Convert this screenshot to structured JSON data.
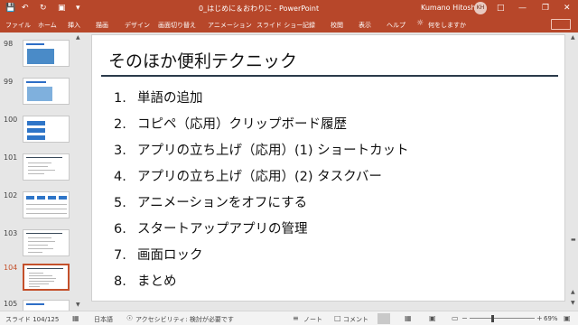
{
  "titlebar": {
    "document_title": "0_はじめに＆おわりに  -  PowerPoint",
    "user_name": "Kumano Hitoshi",
    "user_initials": "KH",
    "save_icon": "save-icon",
    "undo_icon": "undo-icon",
    "redo_icon": "redo-icon",
    "present_icon": "present-icon",
    "customize_icon": "customize-icon",
    "ribbon_display_icon": "ribbon-display-icon",
    "minimize_icon": "minimize-icon",
    "restore_icon": "restore-icon",
    "close_icon": "close-icon"
  },
  "ribbon": {
    "tabs": [
      "ファイル",
      "ホーム",
      "挿入",
      "描画",
      "デザイン",
      "画面切り替え",
      "アニメーション",
      "スライド ショー",
      "記録",
      "校閲",
      "表示",
      "ヘルプ"
    ],
    "tell_me": "何をしますか",
    "lightbulb_icon": "lightbulb-icon",
    "share_icon": "share-icon"
  },
  "thumbnails": {
    "numbers": [
      "98",
      "99",
      "100",
      "101",
      "102",
      "103",
      "104",
      "105"
    ],
    "active": "104"
  },
  "slide": {
    "title": "そのほか便利テクニック",
    "items": [
      {
        "num": "1.",
        "text": "単語の追加"
      },
      {
        "num": "2.",
        "text": "コピペ（応用）クリップボード履歴"
      },
      {
        "num": "3.",
        "text": "アプリの立ち上げ（応用）(1) ショートカット"
      },
      {
        "num": "4.",
        "text": "アプリの立ち上げ（応用）(2) タスクバー"
      },
      {
        "num": "5.",
        "text": "アニメーションをオフにする"
      },
      {
        "num": "6.",
        "text": "スタートアップアプリの管理"
      },
      {
        "num": "7.",
        "text": "画面ロック"
      },
      {
        "num": "8.",
        "text": "まとめ"
      }
    ]
  },
  "statusbar": {
    "slide_counter": "スライド 104/125",
    "language": "日本語",
    "accessibility": "アクセシビリティ: 検討が必要です",
    "notes_label": "ノート",
    "comments_label": "コメント",
    "zoom": "69%",
    "zoom_fraction": 0.69
  },
  "colors": {
    "accent": "#b7472a",
    "active_thumb": "#c4502b",
    "title_rule": "#2b3a4a"
  }
}
